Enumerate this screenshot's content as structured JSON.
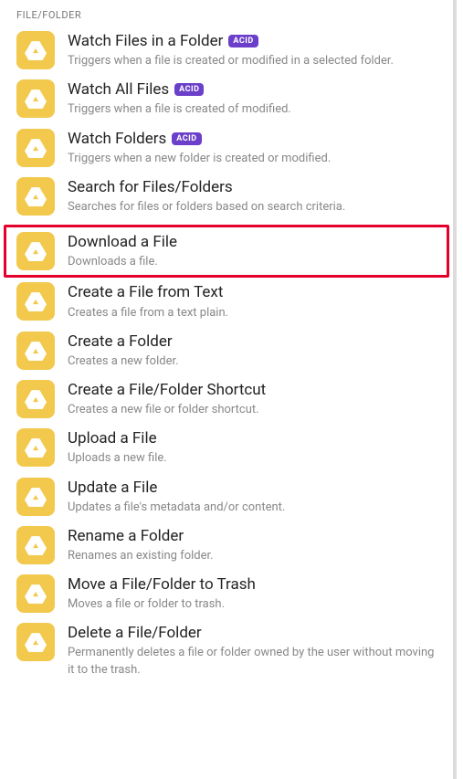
{
  "section_header": "FILE/FOLDER",
  "badge_text": "ACID",
  "items": [
    {
      "title": "Watch Files in a Folder",
      "desc": "Triggers when a file is created or modified in a selected folder.",
      "badge": true,
      "highlighted": false
    },
    {
      "title": "Watch All Files",
      "desc": "Triggers when a file is created of modified.",
      "badge": true,
      "highlighted": false
    },
    {
      "title": "Watch Folders",
      "desc": "Triggers when a new folder is created or modified.",
      "badge": true,
      "highlighted": false
    },
    {
      "title": "Search for Files/Folders",
      "desc": "Searches for files or folders based on search criteria.",
      "badge": false,
      "highlighted": false
    },
    {
      "title": "Download a File",
      "desc": "Downloads a file.",
      "badge": false,
      "highlighted": true
    },
    {
      "title": "Create a File from Text",
      "desc": "Creates a file from a text plain.",
      "badge": false,
      "highlighted": false
    },
    {
      "title": "Create a Folder",
      "desc": "Creates a new folder.",
      "badge": false,
      "highlighted": false
    },
    {
      "title": "Create a File/Folder Shortcut",
      "desc": "Creates a new file or folder shortcut.",
      "badge": false,
      "highlighted": false
    },
    {
      "title": "Upload a File",
      "desc": "Uploads a new file.",
      "badge": false,
      "highlighted": false
    },
    {
      "title": "Update a File",
      "desc": "Updates a file's metadata and/or content.",
      "badge": false,
      "highlighted": false
    },
    {
      "title": "Rename a Folder",
      "desc": "Renames an existing folder.",
      "badge": false,
      "highlighted": false
    },
    {
      "title": "Move a File/Folder to Trash",
      "desc": "Moves a file or folder to trash.",
      "badge": false,
      "highlighted": false
    },
    {
      "title": "Delete a File/Folder",
      "desc": "Permanently deletes a file or folder owned by the user without moving it to the trash.",
      "badge": false,
      "highlighted": false
    }
  ]
}
